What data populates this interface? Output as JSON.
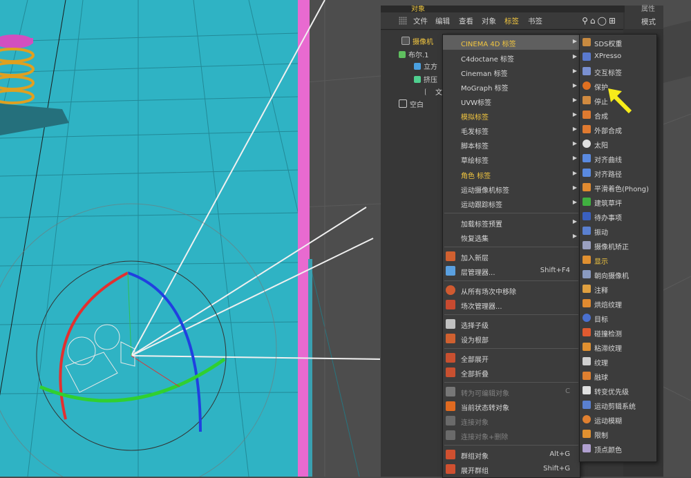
{
  "colors": {
    "accent_yellow": "#f2c640",
    "viewport_bg": "#2fb3c4",
    "panel_bg": "#333333",
    "menu_bg": "#3c3c3c"
  },
  "panel": {
    "title": "对象",
    "attributes_title": "属性",
    "attributes_mode": "模式"
  },
  "menubar": {
    "items": [
      "文件",
      "编辑",
      "查看",
      "对象",
      "标签",
      "书签"
    ],
    "active_index": 4,
    "icons": [
      "search-icon",
      "home-icon",
      "eye-icon",
      "add-icon"
    ]
  },
  "tree": {
    "rows": [
      {
        "label": "摄像机",
        "icon": "camera-icon",
        "highlight": true
      },
      {
        "label": "布尔.1",
        "icon": "boole-icon"
      },
      {
        "label": "立方",
        "icon": "cube-icon"
      },
      {
        "label": "挤压",
        "icon": "extrude-icon"
      },
      {
        "label": "文",
        "icon": "text-icon"
      },
      {
        "label": "空白",
        "icon": "null-icon"
      }
    ]
  },
  "context_menu": {
    "items": [
      {
        "label": "CINEMA 4D 标签",
        "arrow": true,
        "highlight": true,
        "yellow": true
      },
      {
        "label": "C4doctane 标签",
        "arrow": true
      },
      {
        "label": "Cineman 标签",
        "arrow": true
      },
      {
        "label": "MoGraph 标签",
        "arrow": true
      },
      {
        "label": "UVW标签",
        "arrow": true
      },
      {
        "label": "模拟标签",
        "arrow": true,
        "yellow": true
      },
      {
        "label": "毛发标签",
        "arrow": true
      },
      {
        "label": "脚本标签",
        "arrow": true
      },
      {
        "label": "草绘标签",
        "arrow": true
      },
      {
        "label": "角色 标签",
        "arrow": true,
        "yellow": true
      },
      {
        "label": "运动摄像机标签",
        "arrow": true
      },
      {
        "label": "运动跟踪标签",
        "arrow": true
      },
      {
        "label": "加载标签预置",
        "arrow": true
      },
      {
        "label": "恢复选集",
        "arrow": true
      },
      {
        "label": "加入新层",
        "icon": "new-layer-icon"
      },
      {
        "label": "层管理器...",
        "shortcut": "Shift+F4",
        "icon": "layer-manager-icon"
      },
      {
        "label": "从所有场次中移除",
        "icon": "remove-takes-icon"
      },
      {
        "label": "场次管理器...",
        "icon": "take-manager-icon"
      },
      {
        "label": "选择子级",
        "icon": "select-children-icon"
      },
      {
        "label": "设为根部",
        "icon": "set-root-icon"
      },
      {
        "label": "全部展开",
        "icon": "expand-all-icon"
      },
      {
        "label": "全部折叠",
        "icon": "collapse-all-icon"
      },
      {
        "label": "转为可编辑对象",
        "shortcut": "C",
        "disabled": true,
        "icon": "make-editable-icon"
      },
      {
        "label": "当前状态转对象",
        "icon": "state-to-object-icon"
      },
      {
        "label": "连接对象",
        "disabled": true,
        "icon": "connect-objects-icon"
      },
      {
        "label": "连接对象+删除",
        "disabled": true,
        "icon": "connect-delete-icon"
      },
      {
        "label": "群组对象",
        "shortcut": "Alt+G",
        "icon": "group-objects-icon"
      },
      {
        "label": "展开群组",
        "shortcut": "Shift+G",
        "icon": "expand-group-icon"
      }
    ]
  },
  "submenu": {
    "items": [
      {
        "label": "SDS权重",
        "icon": "sds-weight-icon"
      },
      {
        "label": "XPresso",
        "icon": "xpresso-icon"
      },
      {
        "label": "交互标签",
        "icon": "interaction-tag-icon"
      },
      {
        "label": "保护",
        "icon": "protection-icon"
      },
      {
        "label": "停止",
        "icon": "stop-icon"
      },
      {
        "label": "合成",
        "icon": "compositing-icon"
      },
      {
        "label": "外部合成",
        "icon": "external-compositing-icon"
      },
      {
        "label": "太阳",
        "icon": "sun-icon"
      },
      {
        "label": "对齐曲线",
        "icon": "align-to-spline-icon"
      },
      {
        "label": "对齐路径",
        "icon": "align-to-path-icon"
      },
      {
        "label": "平滑着色(Phong)",
        "icon": "phong-icon"
      },
      {
        "label": "建筑草坪",
        "icon": "architectural-grass-icon"
      },
      {
        "label": "待办事项",
        "icon": "todo-icon"
      },
      {
        "label": "振动",
        "icon": "vibrate-icon"
      },
      {
        "label": "摄像机矫正",
        "icon": "camera-calibration-icon"
      },
      {
        "label": "显示",
        "icon": "display-icon",
        "yellow": true
      },
      {
        "label": "朝向摄像机",
        "icon": "look-at-camera-icon"
      },
      {
        "label": "注释",
        "icon": "annotation-icon"
      },
      {
        "label": "烘焙纹理",
        "icon": "bake-texture-icon"
      },
      {
        "label": "目标",
        "icon": "target-icon"
      },
      {
        "label": "碰撞检测",
        "icon": "collision-icon"
      },
      {
        "label": "粘滞纹理",
        "icon": "sticky-texture-icon"
      },
      {
        "label": "纹理",
        "icon": "texture-icon"
      },
      {
        "label": "融球",
        "icon": "metaball-icon"
      },
      {
        "label": "转变优先级",
        "icon": "priority-icon"
      },
      {
        "label": "运动剪辑系统",
        "icon": "motion-system-icon"
      },
      {
        "label": "运动模糊",
        "icon": "motion-blur-icon"
      },
      {
        "label": "限制",
        "icon": "restriction-icon"
      },
      {
        "label": "顶点颜色",
        "icon": "vertex-color-icon"
      }
    ]
  }
}
